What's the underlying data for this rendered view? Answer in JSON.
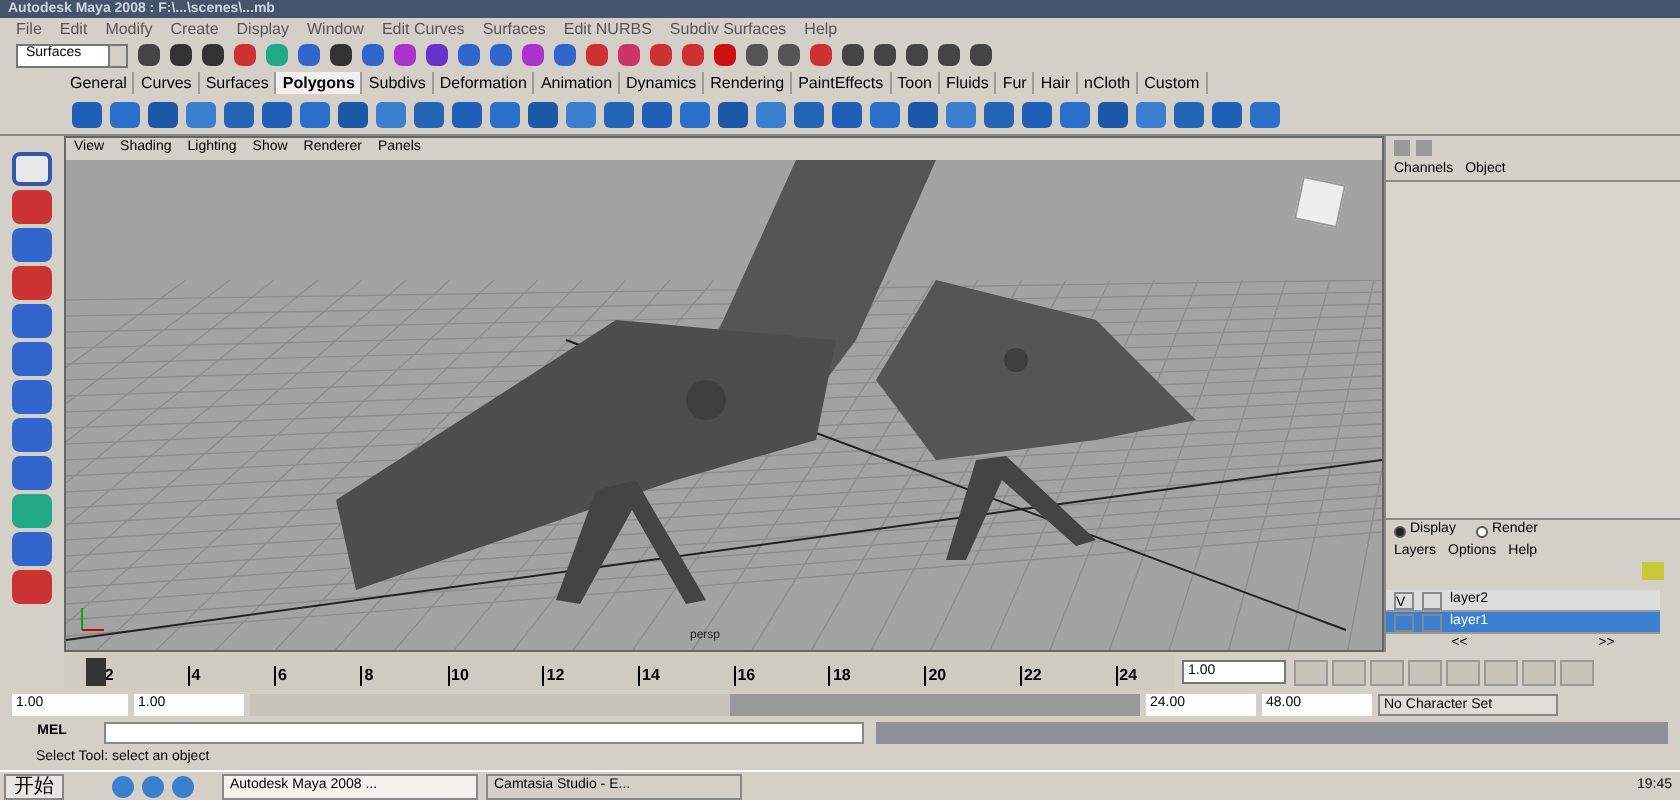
{
  "window": {
    "title": "Autodesk Maya 2008 : F:\\...\\scenes\\...mb"
  },
  "menu": [
    "File",
    "Edit",
    "Modify",
    "Create",
    "Display",
    "Window",
    "Edit Curves",
    "Surfaces",
    "Edit NURBS",
    "Subdiv Surfaces",
    "Help"
  ],
  "menu_set": {
    "value": "Surfaces"
  },
  "shelf_tabs": [
    {
      "label": "General",
      "selected": false
    },
    {
      "label": "Curves",
      "selected": false
    },
    {
      "label": "Surfaces",
      "selected": false
    },
    {
      "label": "Polygons",
      "selected": true
    },
    {
      "label": "Subdivs",
      "selected": false
    },
    {
      "label": "Deformation",
      "selected": false
    },
    {
      "label": "Animation",
      "selected": false
    },
    {
      "label": "Dynamics",
      "selected": false
    },
    {
      "label": "Rendering",
      "selected": false
    },
    {
      "label": "PaintEffects",
      "selected": false
    },
    {
      "label": "Toon",
      "selected": false
    },
    {
      "label": "Fluids",
      "selected": false
    },
    {
      "label": "Fur",
      "selected": false
    },
    {
      "label": "Hair",
      "selected": false
    },
    {
      "label": "nCloth",
      "selected": false
    },
    {
      "label": "Custom",
      "selected": false
    }
  ],
  "panel_menu": [
    "View",
    "Shading",
    "Lighting",
    "Show",
    "Renderer",
    "Panels"
  ],
  "viewport": {
    "camera_label": "persp"
  },
  "channel_box": {
    "menu": [
      "Channels",
      "Object"
    ]
  },
  "layer_editor": {
    "modes": [
      {
        "label": "Display",
        "selected": true
      },
      {
        "label": "Render",
        "selected": false
      }
    ],
    "menu": [
      "Layers",
      "Options",
      "Help"
    ],
    "layers": [
      {
        "visibility": "V",
        "name": "layer2",
        "selected": false
      },
      {
        "name": "layer1",
        "selected": true
      }
    ],
    "scroll_left": "<<",
    "scroll_right": ">>"
  },
  "time_slider": {
    "ticks": [
      "2",
      "4",
      "6",
      "8",
      "10",
      "12",
      "14",
      "16",
      "18",
      "20",
      "22",
      "24"
    ],
    "current_time": "1.00",
    "level": 0.02
  },
  "range_slider": {
    "level": 0.54,
    "start_time": "1.00",
    "playback_start": "1.00",
    "playback_end": "24.00",
    "end_time": "48.00",
    "character_set": "No Character Set"
  },
  "command_line": {
    "label": "MEL"
  },
  "help_line": "Select Tool: select an object",
  "taskbar": {
    "start": "开始",
    "tasks": [
      {
        "label": "Autodesk Maya 2008 ...",
        "selected": true
      },
      {
        "label": "Camtasia Studio - E...",
        "selected": false
      }
    ],
    "clock": "19:45"
  }
}
